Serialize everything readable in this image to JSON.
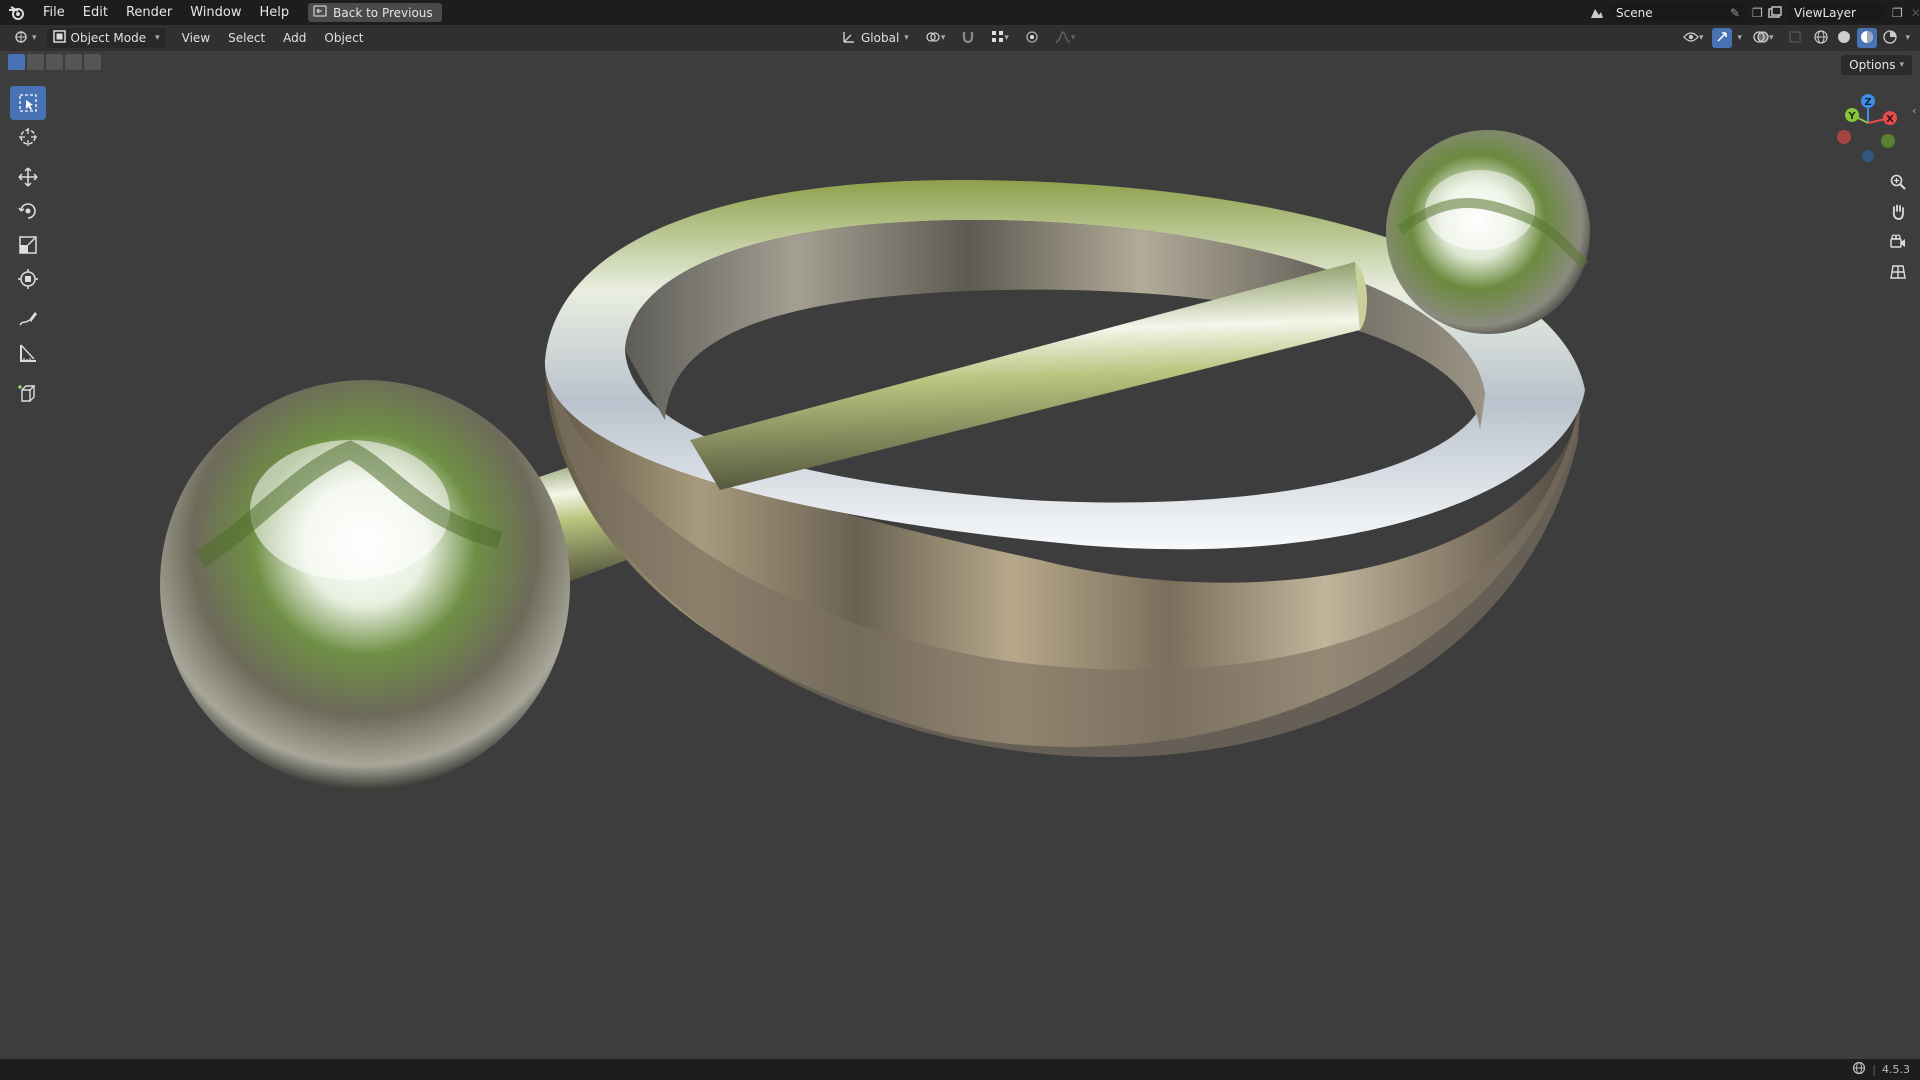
{
  "topbar": {
    "menu": [
      "File",
      "Edit",
      "Render",
      "Window",
      "Help"
    ],
    "back_button": "Back to Previous",
    "scene_name": "Scene",
    "view_layer": "ViewLayer"
  },
  "header": {
    "mode": "Object Mode",
    "menus": [
      "View",
      "Select",
      "Add",
      "Object"
    ],
    "transform_orientation": "Global"
  },
  "viewport": {
    "options_label": "Options",
    "gizmo_axes": [
      "Z",
      "Y",
      "X"
    ]
  },
  "toolbar": {
    "tools": [
      "select-box",
      "cursor",
      "move",
      "rotate",
      "scale",
      "transform",
      "annotate",
      "measure",
      "add-cube"
    ],
    "active": "select-box"
  },
  "status": {
    "version": "4.5.3"
  },
  "colors": {
    "accent": "#4772b3",
    "x_axis": "#e54d4d",
    "y_axis": "#86c53c",
    "z_axis": "#3f8ee8"
  }
}
